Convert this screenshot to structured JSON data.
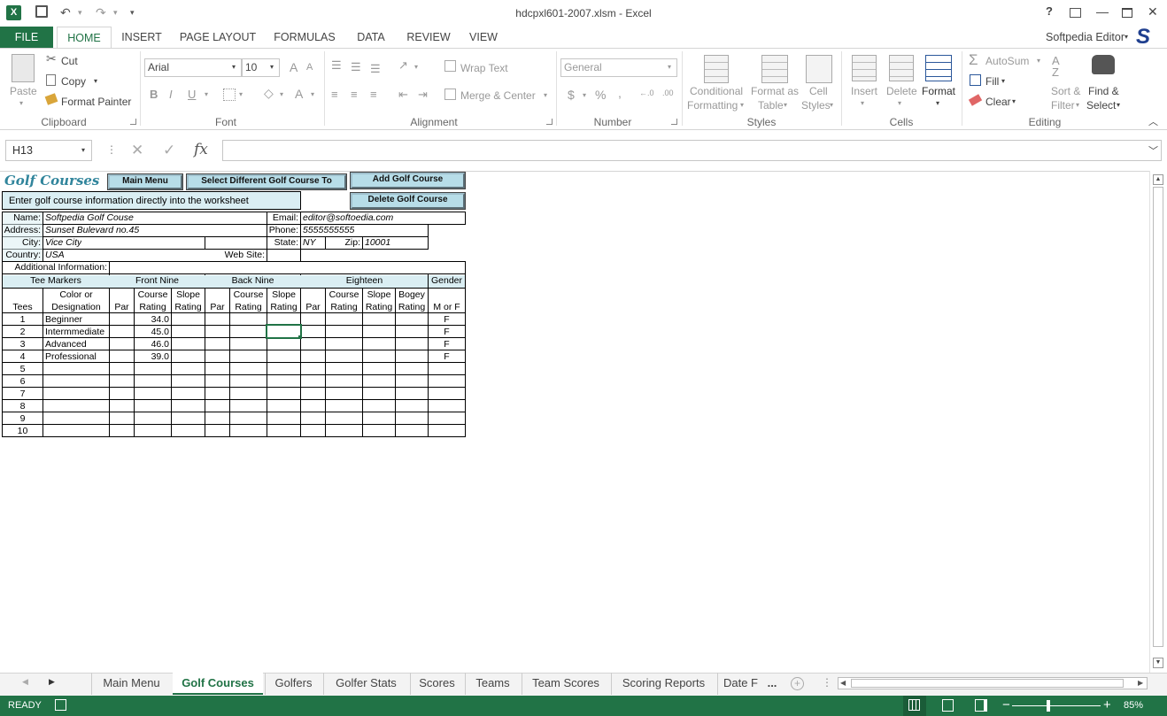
{
  "window": {
    "title": "hdcpxl601-2007.xlsm - Excel",
    "help": "?",
    "min": "—",
    "max": "☐",
    "close": "✕"
  },
  "qat": {
    "save": "💾",
    "undo": "↶",
    "redo": "↷",
    "more": "▾"
  },
  "tabs": {
    "file": "FILE",
    "items": [
      "HOME",
      "INSERT",
      "PAGE LAYOUT",
      "FORMULAS",
      "DATA",
      "REVIEW",
      "VIEW"
    ],
    "user": "Softpedia Editor",
    "user_logo": "S"
  },
  "ribbon": {
    "clipboard": {
      "paste": "Paste",
      "cut": "Cut",
      "copy": "Copy",
      "format_painter": "Format Painter",
      "label": "Clipboard"
    },
    "font": {
      "name": "Arial",
      "size": "10",
      "bold": "B",
      "italic": "I",
      "underline": "U",
      "grow": "A",
      "shrink": "A",
      "label": "Font"
    },
    "alignment": {
      "wrap": "Wrap Text",
      "merge": "Merge & Center",
      "label": "Alignment"
    },
    "number": {
      "format": "General",
      "currency": "$",
      "percent": "%",
      "comma": ",",
      "inc": ".00→.0",
      "label": "Number"
    },
    "styles": {
      "conditional": [
        "Conditional",
        "Formatting"
      ],
      "format_table": [
        "Format as",
        "Table"
      ],
      "cell_styles": [
        "Cell",
        "Styles"
      ],
      "label": "Styles"
    },
    "cells": {
      "insert": "Insert",
      "delete": "Delete",
      "format": "Format",
      "label": "Cells"
    },
    "editing": {
      "autosum": "AutoSum",
      "fill": "Fill",
      "clear": "Clear",
      "sort": [
        "Sort &",
        "Filter"
      ],
      "find": [
        "Find &",
        "Select"
      ],
      "label": "Editing"
    }
  },
  "formula_bar": {
    "name_box": "H13",
    "cancel": "✕",
    "enter": "✓",
    "fx": "fx",
    "value": ""
  },
  "sheet": {
    "title": "Golf Courses",
    "buttons": {
      "main_menu": "Main Menu",
      "select_course": "Select Different Golf Course To",
      "add_course": "Add Golf Course",
      "delete_course": "Delete Golf Course"
    },
    "instruction": "Enter golf course information directly into the worksheet",
    "labels": {
      "name": "Name:",
      "address": "Address:",
      "city": "City:",
      "country": "Country:",
      "additional": "Additional Information:",
      "email": "Email:",
      "phone": "Phone:",
      "state": "State:",
      "zip": "Zip:",
      "website": "Web Site:"
    },
    "values": {
      "name": "Softpedia Golf Couse",
      "address": "Sunset Bulevard no.45",
      "city": "Vice City",
      "country": "USA",
      "email": "editor@softoedia.com",
      "phone": "5555555555",
      "state": "NY",
      "zip": "10001",
      "website": "",
      "additional": ""
    },
    "groups": {
      "tee_markers": "Tee Markers",
      "front_nine": "Front Nine",
      "back_nine": "Back Nine",
      "eighteen": "Eighteen",
      "gender": "Gender"
    },
    "col_headers_top": [
      "",
      "Color or",
      "",
      "Course",
      "Slope",
      "",
      "Course",
      "Slope",
      "",
      "Course",
      "Slope",
      "Bogey",
      ""
    ],
    "col_headers_bottom": [
      "Tees",
      "Designation",
      "Par",
      "Rating",
      "Rating",
      "Par",
      "Rating",
      "Rating",
      "Par",
      "Rating",
      "Rating",
      "Rating",
      "M or F"
    ],
    "rows": [
      {
        "tees": "1",
        "designation": "Beginner",
        "front_rating": "34.0",
        "gender": "F"
      },
      {
        "tees": "2",
        "designation": "Intermmediate",
        "front_rating": "45.0",
        "gender": "F"
      },
      {
        "tees": "3",
        "designation": "Advanced",
        "front_rating": "46.0",
        "gender": "F"
      },
      {
        "tees": "4",
        "designation": "Professional",
        "front_rating": "39.0",
        "gender": "F"
      },
      {
        "tees": "5",
        "designation": "",
        "front_rating": "",
        "gender": ""
      },
      {
        "tees": "6",
        "designation": "",
        "front_rating": "",
        "gender": ""
      },
      {
        "tees": "7",
        "designation": "",
        "front_rating": "",
        "gender": ""
      },
      {
        "tees": "8",
        "designation": "",
        "front_rating": "",
        "gender": ""
      },
      {
        "tees": "9",
        "designation": "",
        "front_rating": "",
        "gender": ""
      },
      {
        "tees": "10",
        "designation": "",
        "front_rating": "",
        "gender": ""
      }
    ]
  },
  "sheet_tabs": {
    "items": [
      "Main Menu",
      "Golf Courses",
      "Golfers",
      "Golfer Stats",
      "Scores",
      "Teams",
      "Team Scores",
      "Scoring Reports",
      "Date F"
    ],
    "active": "Golf Courses",
    "more": "..."
  },
  "status": {
    "ready": "READY",
    "zoom": "85%"
  },
  "colors": {
    "excel_green": "#217346",
    "button_fill": "#b7dde8",
    "title_text": "#31859c"
  }
}
